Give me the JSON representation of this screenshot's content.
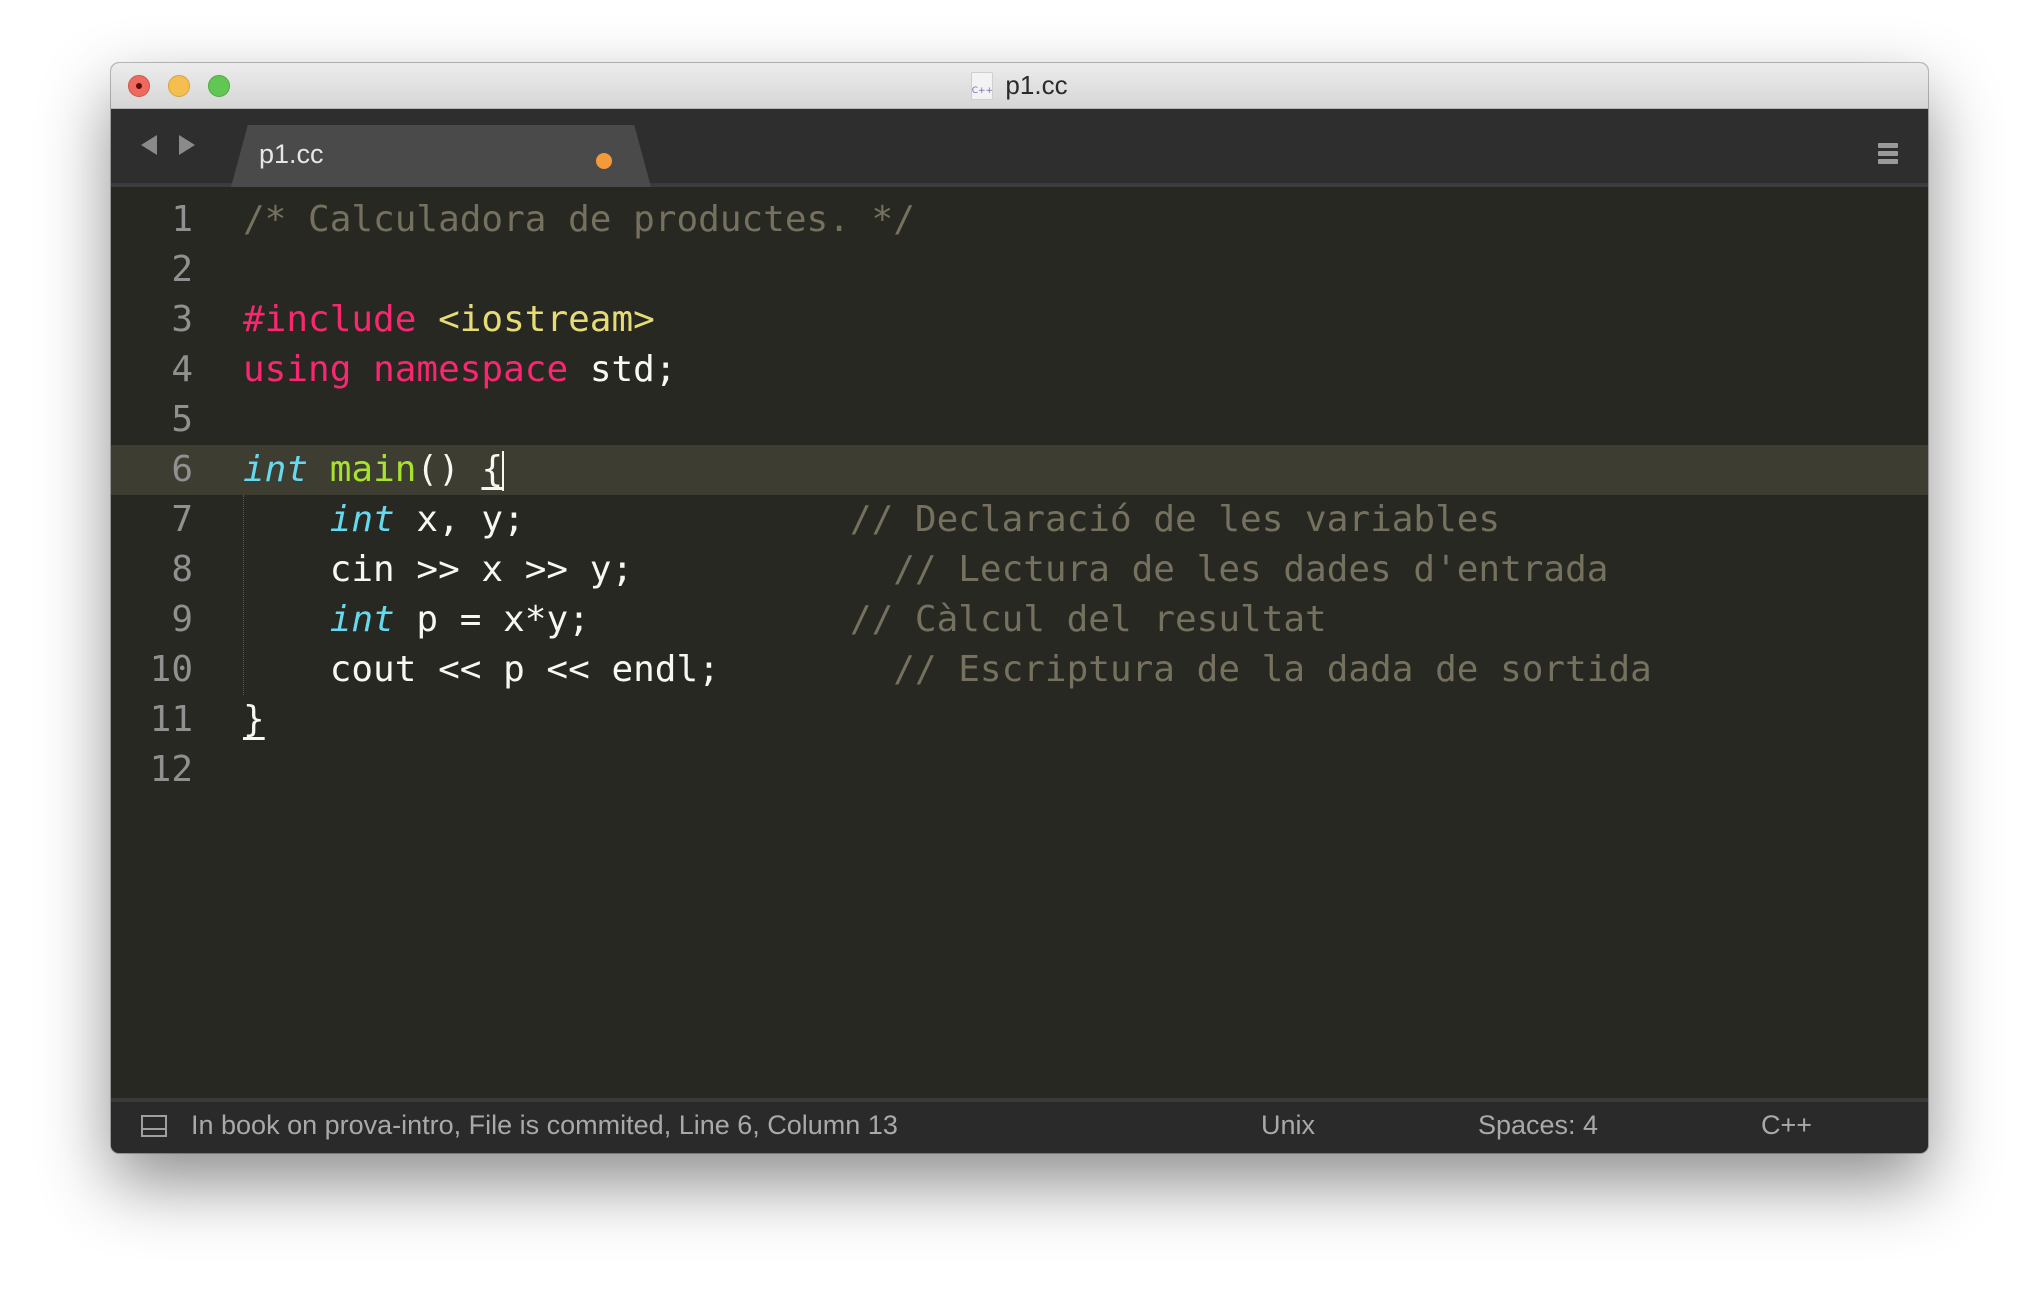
{
  "window": {
    "title": "p1.cc",
    "title_icon": "cpp-file-icon",
    "title_icon_text": "C++"
  },
  "tabs": [
    {
      "label": "p1.cc",
      "active": true,
      "modified": true,
      "modified_color": "#f59a3a"
    }
  ],
  "editor": {
    "current_line": 6,
    "theme": {
      "background": "#272822",
      "keyword": "#f92672",
      "string": "#e6db74",
      "type": "#66d9ef",
      "function": "#a6e22e",
      "comment": "#75715e",
      "text": "#f8f8f2"
    },
    "lines": [
      {
        "n": "1",
        "tokens": [
          {
            "t": "/* Calculadora de productes. */",
            "c": "cm"
          }
        ]
      },
      {
        "n": "2",
        "tokens": []
      },
      {
        "n": "3",
        "tokens": [
          {
            "t": "#include",
            "c": "kw"
          },
          {
            "t": " ",
            "c": ""
          },
          {
            "t": "<iostream>",
            "c": "str"
          }
        ]
      },
      {
        "n": "4",
        "tokens": [
          {
            "t": "using",
            "c": "kw"
          },
          {
            "t": " ",
            "c": ""
          },
          {
            "t": "namespace",
            "c": "kw"
          },
          {
            "t": " std;",
            "c": ""
          }
        ]
      },
      {
        "n": "5",
        "tokens": []
      },
      {
        "n": "6",
        "tokens": [
          {
            "t": "int",
            "c": "type"
          },
          {
            "t": " ",
            "c": ""
          },
          {
            "t": "main",
            "c": "fn"
          },
          {
            "t": "() ",
            "c": ""
          },
          {
            "t": "{",
            "c": "brace-ul"
          }
        ]
      },
      {
        "n": "7",
        "tokens": [
          {
            "t": "    ",
            "c": ""
          },
          {
            "t": "int",
            "c": "type"
          },
          {
            "t": " x, y;               ",
            "c": ""
          },
          {
            "t": "// Declaració de les variables",
            "c": "cm"
          }
        ]
      },
      {
        "n": "8",
        "tokens": [
          {
            "t": "    cin >> x >> y;            ",
            "c": ""
          },
          {
            "t": "// Lectura de les dades d'entrada",
            "c": "cm"
          }
        ]
      },
      {
        "n": "9",
        "tokens": [
          {
            "t": "    ",
            "c": ""
          },
          {
            "t": "int",
            "c": "type"
          },
          {
            "t": " p = x*y;            ",
            "c": ""
          },
          {
            "t": "// Càlcul del resultat",
            "c": "cm"
          }
        ]
      },
      {
        "n": "10",
        "tokens": [
          {
            "t": "    cout << p << endl;        ",
            "c": ""
          },
          {
            "t": "// Escriptura de la dada de sortida",
            "c": "cm"
          }
        ]
      },
      {
        "n": "11",
        "tokens": [
          {
            "t": "}",
            "c": "brace-ul"
          }
        ]
      },
      {
        "n": "12",
        "tokens": []
      }
    ]
  },
  "statusbar": {
    "panel_icon": "panel-toggle-icon",
    "message": "In book on prova-intro, File is commited, Line 6, Column 13",
    "line_endings": "Unix",
    "indentation": "Spaces: 4",
    "syntax": "C++"
  }
}
